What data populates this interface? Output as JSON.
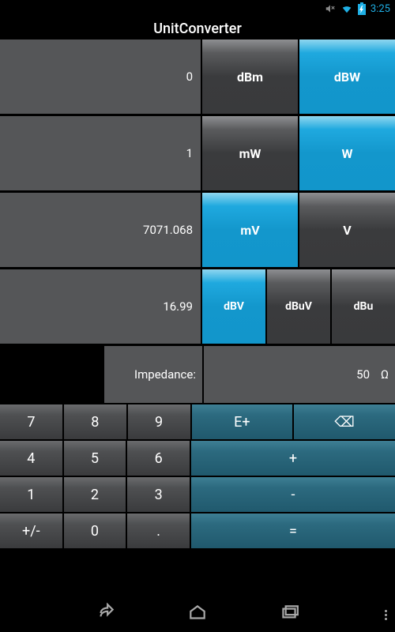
{
  "statusbar": {
    "time": "3:25"
  },
  "title": "UnitConverter",
  "rows": [
    {
      "value": "0",
      "units": [
        {
          "label": "dBm",
          "selected": false
        },
        {
          "label": "dBW",
          "selected": true
        }
      ]
    },
    {
      "value": "1",
      "units": [
        {
          "label": "mW",
          "selected": false
        },
        {
          "label": "W",
          "selected": true
        }
      ]
    },
    {
      "value": "7071.068",
      "units": [
        {
          "label": "mV",
          "selected": true
        },
        {
          "label": "V",
          "selected": false
        }
      ]
    },
    {
      "value": "16.99",
      "units": [
        {
          "label": "dBV",
          "selected": true
        },
        {
          "label": "dBuV",
          "selected": false
        },
        {
          "label": "dBu",
          "selected": false
        }
      ]
    }
  ],
  "impedance": {
    "label": "Impedance:",
    "value": "50",
    "unit": "Ω"
  },
  "keypad": {
    "k7": "7",
    "k8": "8",
    "k9": "9",
    "eplus": "E+",
    "bksp": "⌫",
    "k4": "4",
    "k5": "5",
    "k6": "6",
    "plus": "+",
    "k1": "1",
    "k2": "2",
    "k3": "3",
    "minus": "-",
    "pm": "+/-",
    "k0": "0",
    "dot": ".",
    "eq": "="
  }
}
